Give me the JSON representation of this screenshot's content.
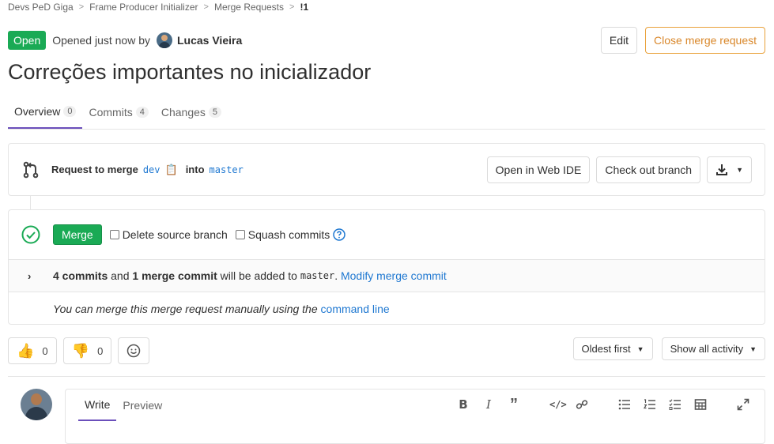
{
  "breadcrumb": {
    "items": [
      "Devs PeD Giga",
      "Frame Producer Initializer",
      "Merge Requests",
      "!1"
    ],
    "separator": ">"
  },
  "header": {
    "status": "Open",
    "opened_text": "Opened just now by",
    "author": "Lucas Vieira",
    "edit_label": "Edit",
    "close_label": "Close merge request"
  },
  "title": "Correções importantes no inicializador",
  "tabs": [
    {
      "label": "Overview",
      "count": "0"
    },
    {
      "label": "Commits",
      "count": "4"
    },
    {
      "label": "Changes",
      "count": "5"
    }
  ],
  "merge_info": {
    "request_label": "Request to merge",
    "source_branch": "dev",
    "into_label": "into",
    "target_branch": "master",
    "web_ide_label": "Open in Web IDE",
    "checkout_label": "Check out branch"
  },
  "widget": {
    "merge_label": "Merge",
    "delete_source_label": "Delete source branch",
    "squash_label": "Squash commits",
    "commits_count": "4 commits",
    "and_text": "and",
    "merge_commit": "1 merge commit",
    "added_text": "will be added to",
    "target": "master",
    "period": ".",
    "modify_label": "Modify merge commit",
    "manual_text": "You can merge this merge request manually using the",
    "command_line_label": "command line"
  },
  "awards": {
    "thumbs_up_count": "0",
    "thumbs_down_count": "0"
  },
  "sort": {
    "order_label": "Oldest first",
    "filter_label": "Show all activity"
  },
  "comment": {
    "write_label": "Write",
    "preview_label": "Preview"
  },
  "colors": {
    "open_badge": "#1aaa55",
    "link": "#1f78d1",
    "active_tab": "#6b4fbb",
    "close_button": "#e9a13a"
  }
}
